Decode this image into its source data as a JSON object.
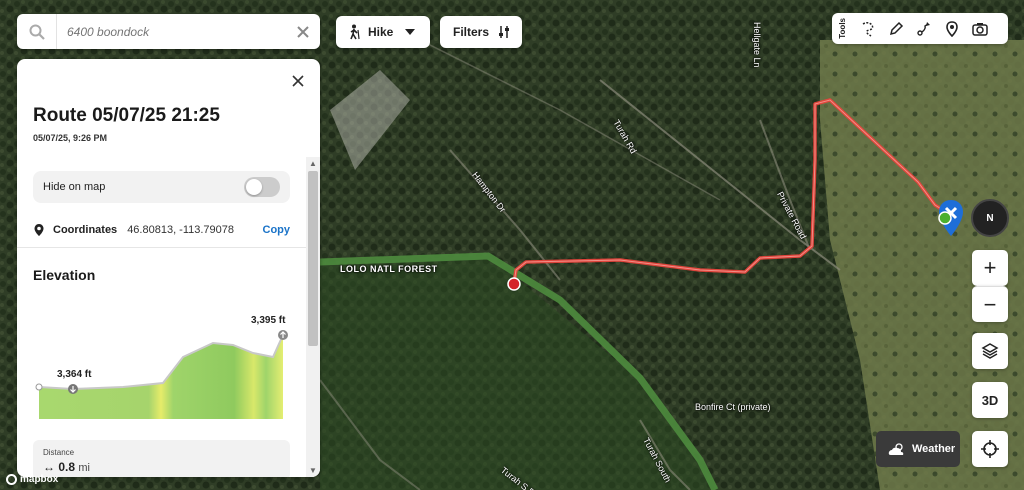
{
  "search": {
    "placeholder": "6400 boondock"
  },
  "activity": {
    "label": "Hike"
  },
  "filters": {
    "label": "Filters"
  },
  "tools": {
    "label": "Tools",
    "items": [
      "lasso-icon",
      "pencil-icon",
      "route-icon",
      "pin-icon",
      "camera-icon"
    ]
  },
  "map": {
    "labels": {
      "turah_rd": "Turah Rd",
      "hampton_dr": "Hampton Dr",
      "private_road": "Private Road",
      "hellgate_ln": "Hellgate Ln",
      "lolo_forest": "LOLO NATL FOREST",
      "bonfire_ct": "Bonfire Ct (private)",
      "turah_south": "Turah South",
      "turah_s_d": "Turah S D"
    },
    "attribution": "mapbox",
    "route_color": "#e8453c",
    "forest_border_color": "#4e8b3e"
  },
  "controls": {
    "compass": "N",
    "zoom_in": "+",
    "zoom_out": "−",
    "three_d": "3D",
    "weather": "Weather"
  },
  "panel": {
    "title": "Route 05/07/25 21:25",
    "subtitle": "05/07/25, 9:26 PM",
    "hide_on_map": "Hide on map",
    "hide_on_map_enabled": false,
    "coordinates_label": "Coordinates",
    "coordinates_value": "46.80813, -113.79078",
    "copy_label": "Copy",
    "elevation_title": "Elevation",
    "distance_label": "Distance",
    "distance_value": "0.8",
    "distance_unit": "mi"
  },
  "elevation": {
    "start_label": "3,364 ft",
    "end_label": "3,395 ft",
    "fill_color": "#9fd46a",
    "line_color": "#c8c8c8"
  }
}
